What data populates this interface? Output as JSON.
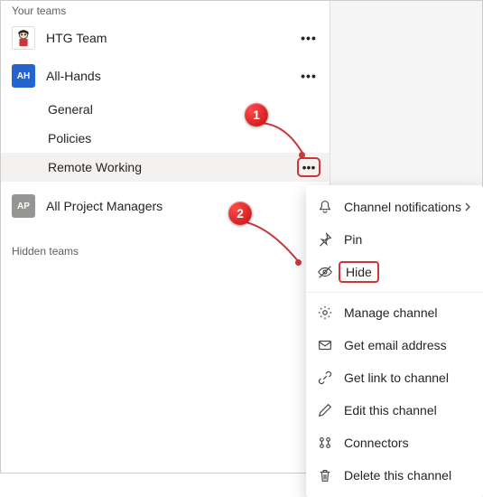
{
  "sections": {
    "your_teams": "Your teams",
    "hidden_teams": "Hidden teams"
  },
  "teams": {
    "htg": {
      "name": "HTG Team"
    },
    "allhands": {
      "name": "All-Hands",
      "initials": "AH",
      "channels": {
        "general": "General",
        "policies": "Policies",
        "remote": "Remote Working"
      }
    },
    "apm": {
      "name": "All Project Managers",
      "initials": "AP"
    }
  },
  "menu": {
    "notifications": "Channel notifications",
    "pin": "Pin",
    "hide": "Hide",
    "manage": "Manage channel",
    "email": "Get email address",
    "link": "Get link to channel",
    "edit": "Edit this channel",
    "connectors": "Connectors",
    "delete": "Delete this channel"
  },
  "callouts": {
    "one": "1",
    "two": "2"
  }
}
